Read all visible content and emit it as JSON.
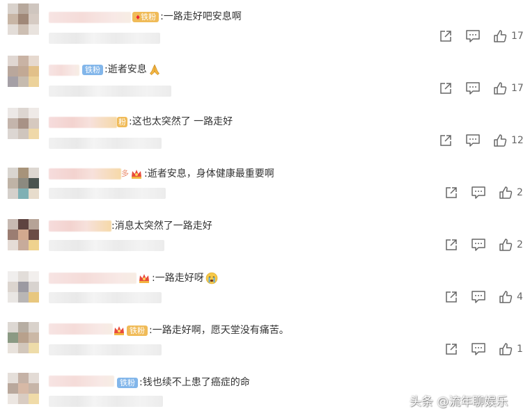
{
  "colors": {
    "text": "#333333",
    "icon": "#666666",
    "fan_badge_blue": "#82b6ea",
    "fan_badge_gold": "#f0bb58"
  },
  "comments": [
    {
      "text": ":一路走好吧安息啊",
      "badge": "铁粉",
      "badge_style": "gold",
      "likes": "17",
      "emoji": ""
    },
    {
      "text": ":逝者安息",
      "badge": "铁粉",
      "badge_style": "blue",
      "likes": "17",
      "emoji": "pray-emoji"
    },
    {
      "text": ":这也太突然了 一路走好",
      "badge": "粉",
      "badge_style": "gold",
      "likes": "12",
      "emoji": ""
    },
    {
      "text": ":逝者安息，身体健康最重要啊",
      "badge": "",
      "badge_style": "crown",
      "name_suffix": "多",
      "likes": "2",
      "emoji": ""
    },
    {
      "text": ":消息太突然了一路走好",
      "badge": "",
      "badge_style": "none",
      "likes": "2",
      "emoji": ""
    },
    {
      "text": ":一路走好呀",
      "badge": "",
      "badge_style": "crown",
      "likes": "4",
      "emoji": "crying-emoji"
    },
    {
      "text": ":一路走好啊，愿天堂没有痛苦。",
      "badge": "铁粉",
      "badge_style": "crown-gold",
      "likes": "1",
      "emoji": ""
    },
    {
      "text": ":钱也续不上患了癌症的命",
      "badge": "铁粉",
      "badge_style": "blue",
      "likes": "",
      "emoji": ""
    }
  ],
  "icons": {
    "share": "share-icon",
    "comment": "comment-icon",
    "like": "thumbs-up-icon"
  },
  "watermark": "头条 @流年聊娱乐"
}
